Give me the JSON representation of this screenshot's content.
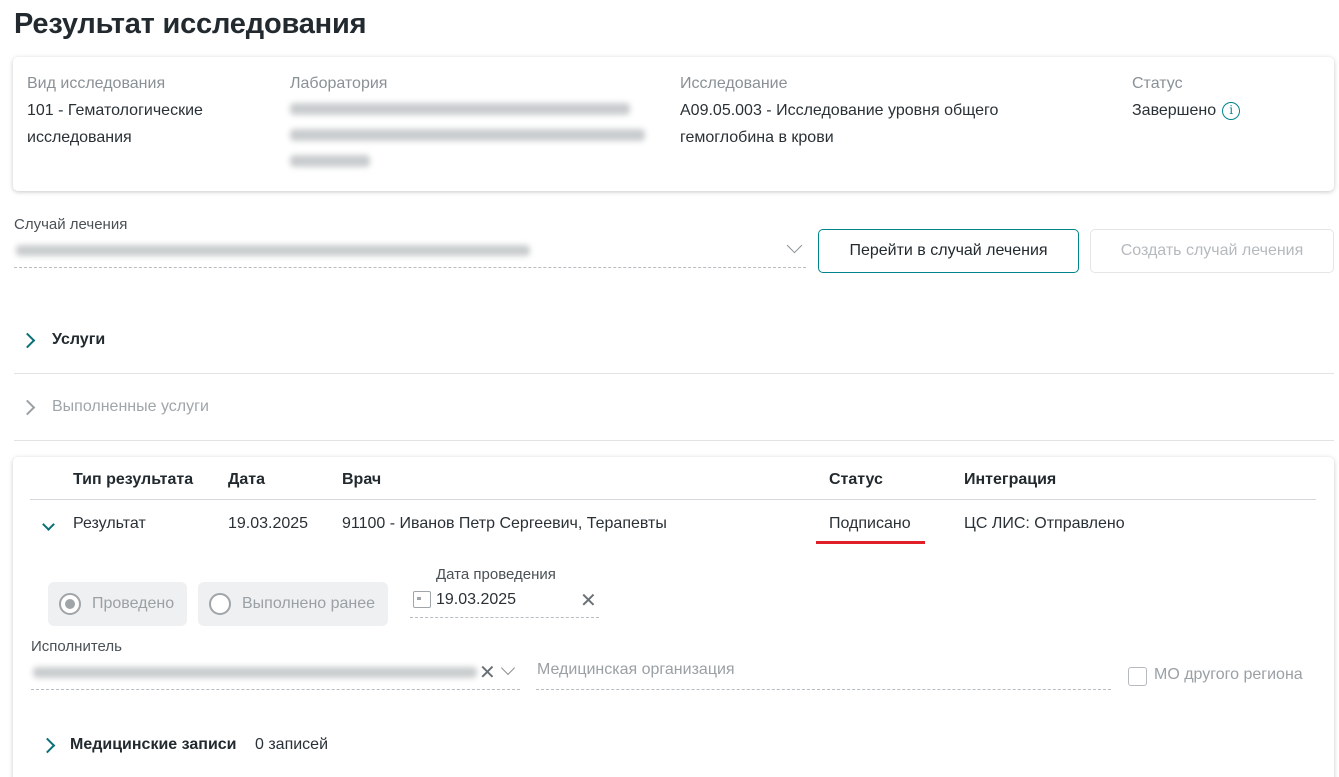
{
  "page": {
    "title": "Результат исследования"
  },
  "info": {
    "type_label": "Вид исследования",
    "type_value_line1": "101 - Гематологические",
    "type_value_line2": "исследования",
    "lab_label": "Лаборатория",
    "study_label": "Исследование",
    "study_value_line1": "A09.05.003 - Исследование уровня общего",
    "study_value_line2": "гемоглобина в крови",
    "status_label": "Статус",
    "status_value": "Завершено",
    "status_info_icon": "info-icon"
  },
  "case": {
    "label": "Случай лечения",
    "go_button": "Перейти в случай лечения",
    "create_button": "Создать случай лечения"
  },
  "sections": {
    "services": "Услуги",
    "done_services": "Выполненные услуги"
  },
  "results_table": {
    "columns": [
      "Тип результата",
      "Дата",
      "Врач",
      "Статус",
      "Интеграция"
    ],
    "rows": [
      {
        "type": "Результат",
        "date": "19.03.2025",
        "doctor": "91100 - Иванов Петр Сергеевич, Терапевты",
        "status": "Подписано",
        "integration": "ЦС ЛИС: Отправлено"
      }
    ]
  },
  "result_form": {
    "radio_done": "Проведено",
    "radio_earlier": "Выполнено ранее",
    "radio_selected": "Проведено",
    "date_label": "Дата проведения",
    "date_value": "19.03.2025",
    "executor_label": "Исполнитель",
    "org_placeholder": "Медицинская организация",
    "other_region_checkbox": "МО другого региона",
    "other_region_checked": false
  },
  "med_records": {
    "title": "Медицинские записи",
    "count": "0 записей"
  },
  "colors": {
    "accent": "#00848c",
    "chevron": "#0a6f78",
    "status_underline": "#e01f26"
  }
}
